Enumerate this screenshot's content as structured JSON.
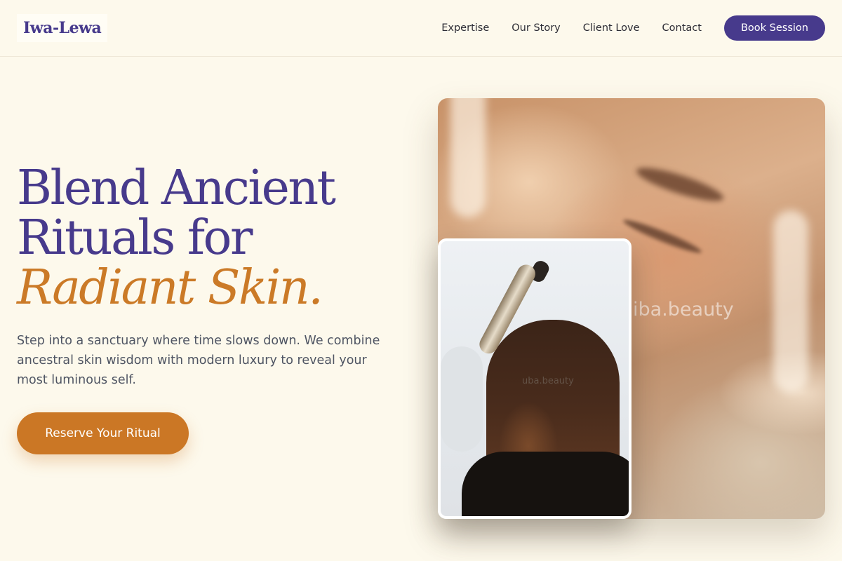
{
  "header": {
    "logo": "Iwa-Lewa",
    "nav": [
      "Expertise",
      "Our Story",
      "Client Love",
      "Contact"
    ],
    "book_label": "Book Session"
  },
  "hero": {
    "headline_line1": "Blend Ancient",
    "headline_line2": "Rituals for",
    "headline_accent": "Radiant Skin.",
    "lead": "Step into a sanctuary where time slows down. We combine ancestral skin wisdom with modern luxury to reveal your most luminous self.",
    "cta_label": "Reserve Your Ritual"
  },
  "images": {
    "main_watermark": "iba.beauty",
    "inset_watermark": "uba.beauty"
  },
  "colors": {
    "background": "#fdf9ec",
    "primary": "#473a8c",
    "accent": "#cb7725"
  }
}
